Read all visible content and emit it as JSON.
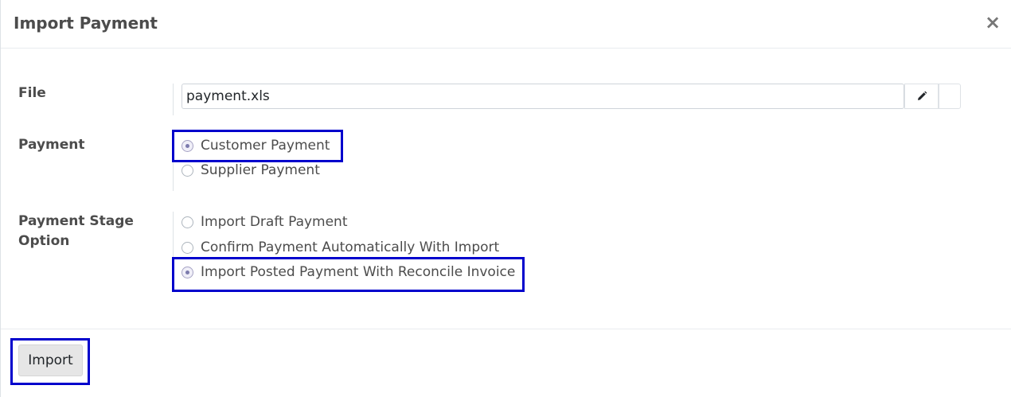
{
  "dialog": {
    "title": "Import Payment",
    "close_icon": "close-icon"
  },
  "form": {
    "file": {
      "label": "File",
      "value": "payment.xls",
      "edit_icon": "pencil-icon"
    },
    "payment": {
      "label": "Payment",
      "options": [
        {
          "label": "Customer Payment",
          "checked": true
        },
        {
          "label": "Supplier Payment",
          "checked": false
        }
      ]
    },
    "stage": {
      "label_line1": "Payment Stage",
      "label_line2": "Option",
      "options": [
        {
          "label": "Import Draft Payment",
          "checked": false
        },
        {
          "label": "Confirm Payment Automatically With Import",
          "checked": false
        },
        {
          "label": "Import Posted Payment With Reconcile Invoice",
          "checked": true
        }
      ]
    }
  },
  "footer": {
    "import_label": "Import"
  },
  "colors": {
    "highlight": "#0000cc",
    "radio_checked": "#7c7bad"
  }
}
